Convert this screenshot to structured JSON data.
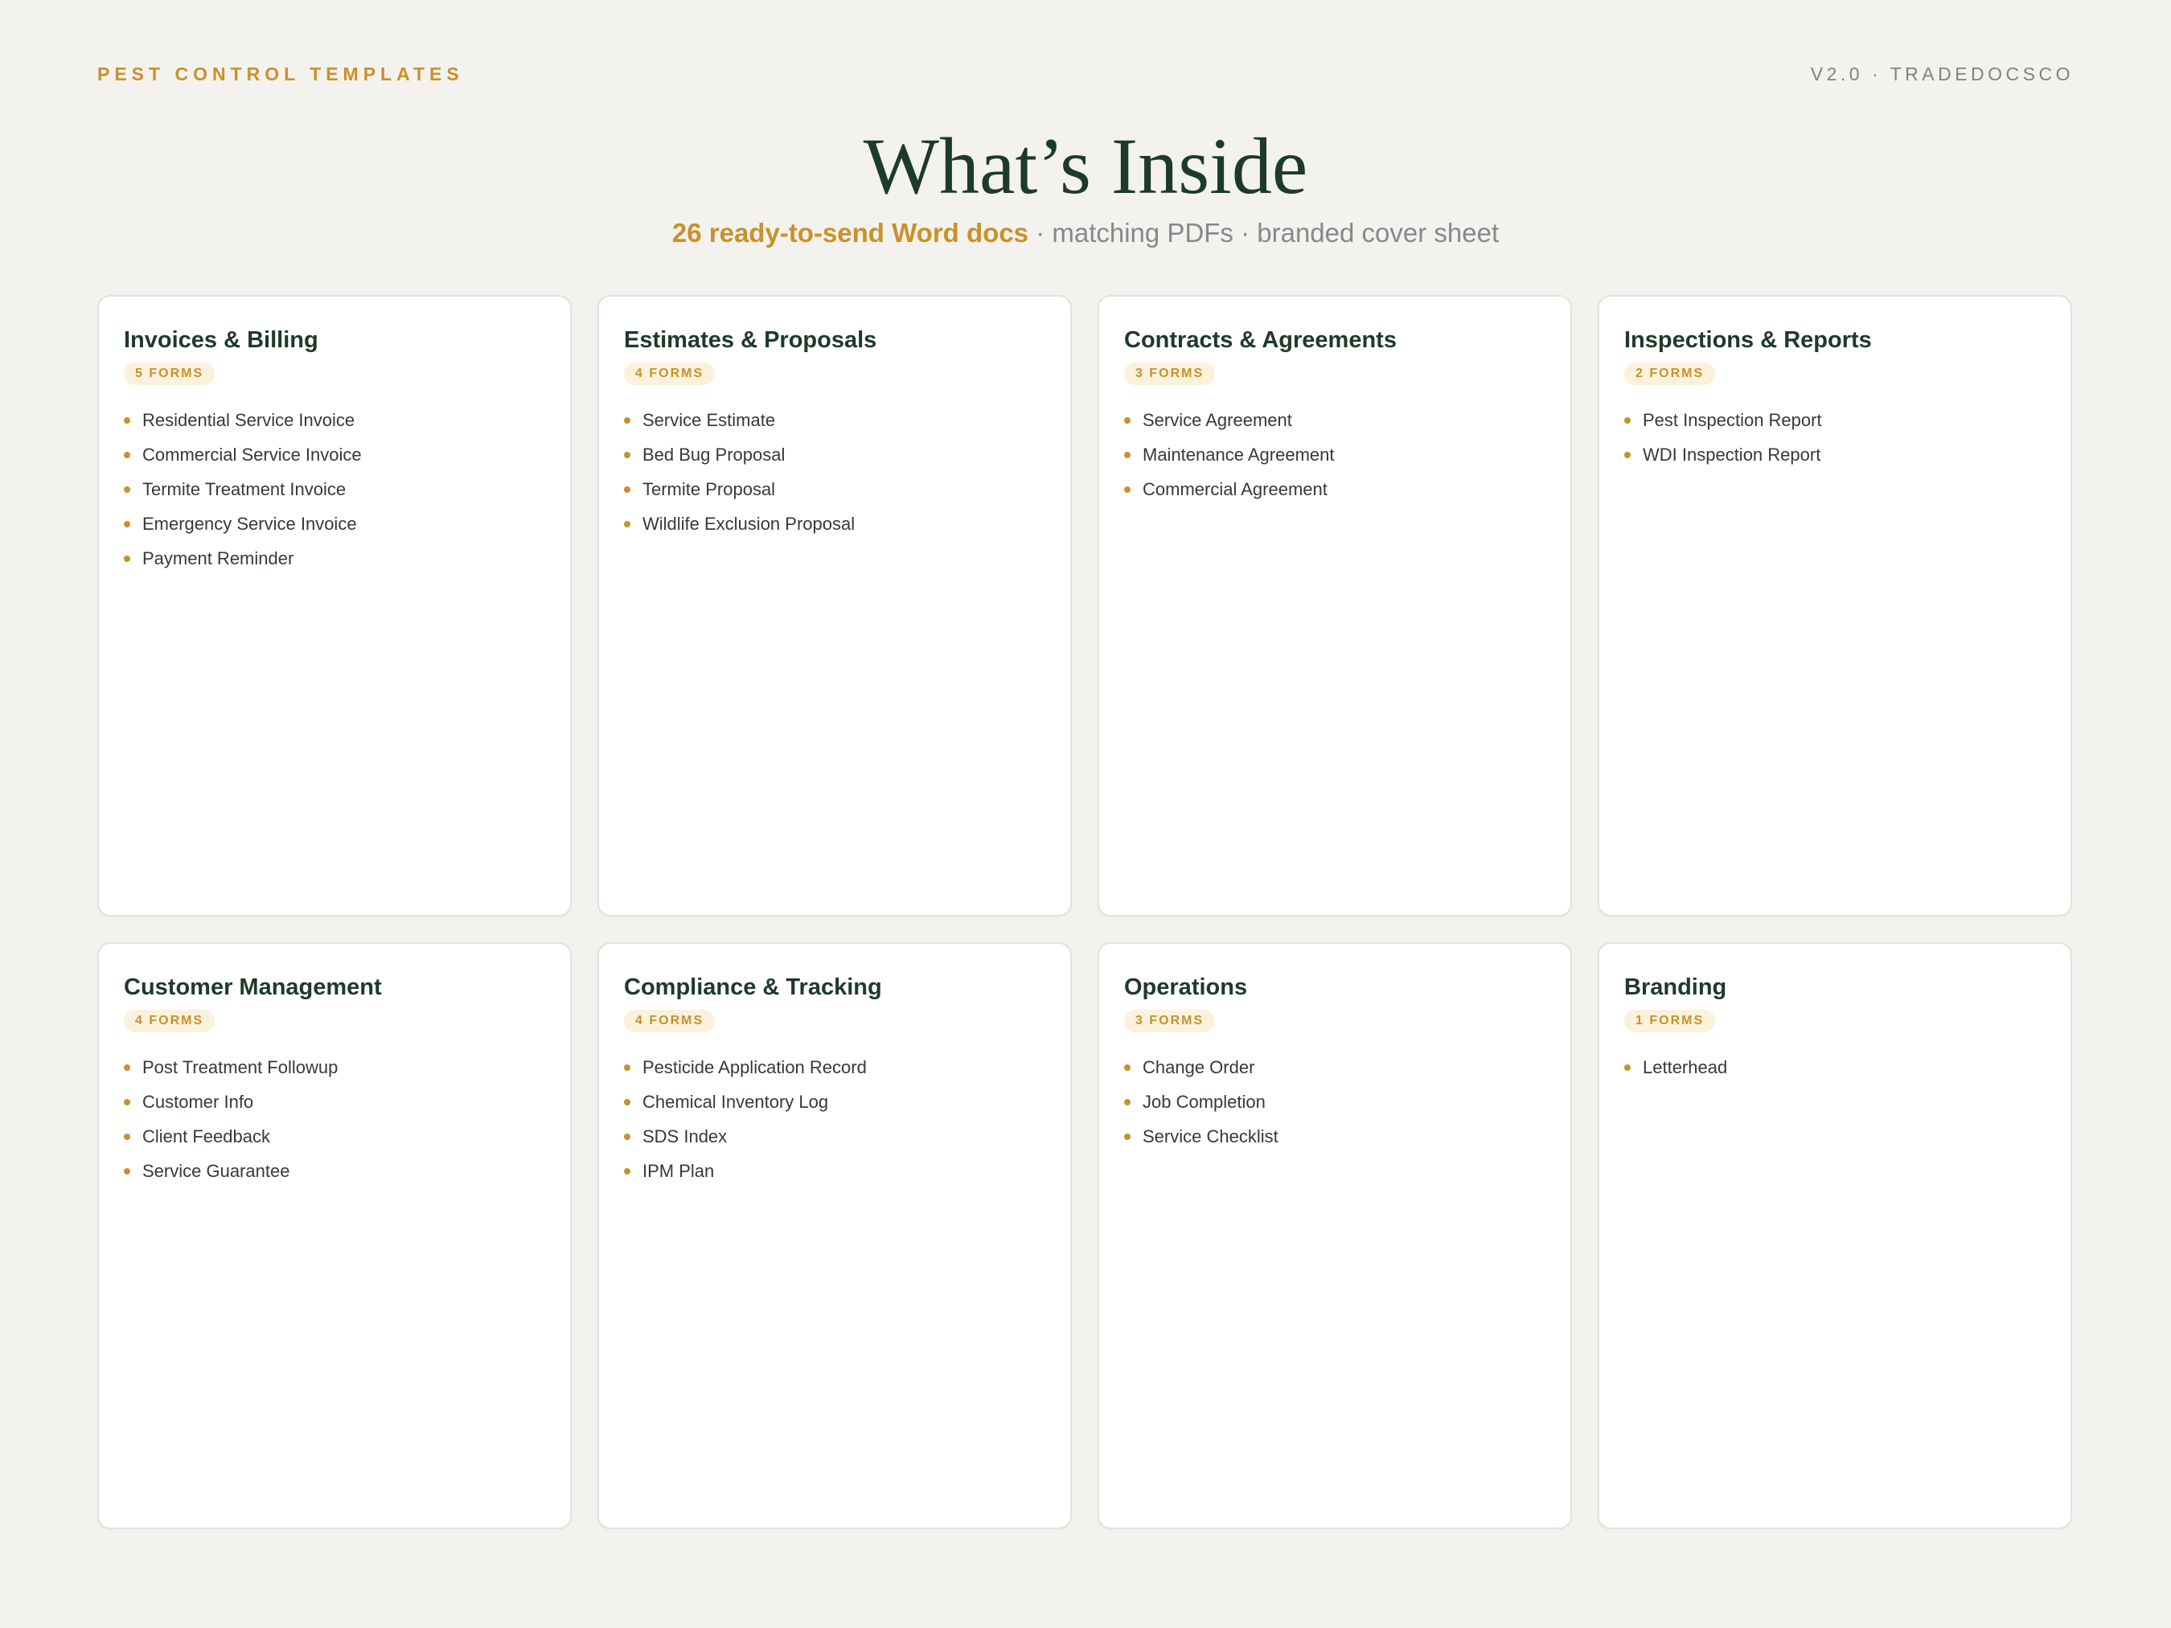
{
  "header": {
    "left_label": "PEST CONTROL TEMPLATES",
    "right_label": "V2.0 · TRADEDOCSCO",
    "title": "What’s Inside",
    "subtitle_highlight": "26 ready-to-send Word docs",
    "subtitle_rest": " · matching PDFs · branded cover sheet"
  },
  "colors": {
    "accent": "#c9912a",
    "title": "#1d3a2a",
    "background": "#f3f2ee"
  },
  "cards": [
    {
      "title": "Invoices & Billing",
      "badge": "5 FORMS",
      "items": [
        "Residential Service Invoice",
        "Commercial Service Invoice",
        "Termite Treatment Invoice",
        "Emergency Service Invoice",
        "Payment Reminder"
      ]
    },
    {
      "title": "Estimates & Proposals",
      "badge": "4 FORMS",
      "items": [
        "Service Estimate",
        "Bed Bug Proposal",
        "Termite Proposal",
        "Wildlife Exclusion Proposal"
      ]
    },
    {
      "title": "Contracts & Agreements",
      "badge": "3 FORMS",
      "items": [
        "Service Agreement",
        "Maintenance Agreement",
        "Commercial Agreement"
      ]
    },
    {
      "title": "Inspections & Reports",
      "badge": "2 FORMS",
      "items": [
        "Pest Inspection Report",
        "WDI Inspection Report"
      ]
    },
    {
      "title": "Customer Management",
      "badge": "4 FORMS",
      "items": [
        "Post Treatment Followup",
        "Customer Info",
        "Client Feedback",
        "Service Guarantee"
      ]
    },
    {
      "title": "Compliance & Tracking",
      "badge": "4 FORMS",
      "items": [
        "Pesticide Application Record",
        "Chemical Inventory Log",
        "SDS Index",
        "IPM Plan"
      ]
    },
    {
      "title": "Operations",
      "badge": "3 FORMS",
      "items": [
        "Change Order",
        "Job Completion",
        "Service Checklist"
      ]
    },
    {
      "title": "Branding",
      "badge": "1 FORMS",
      "items": [
        "Letterhead"
      ]
    }
  ]
}
